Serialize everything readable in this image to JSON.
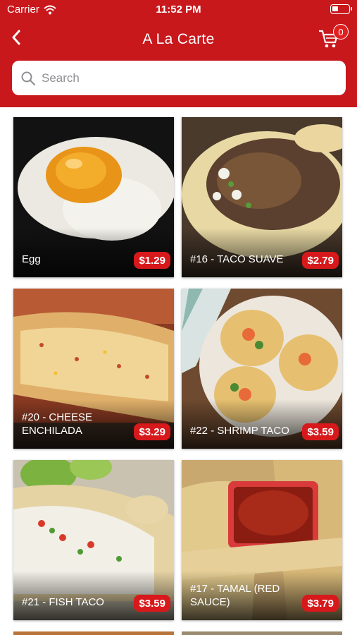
{
  "status": {
    "carrier": "Carrier",
    "time": "11:52 PM"
  },
  "nav": {
    "title": "A La Carte",
    "cart_count": "0"
  },
  "search": {
    "placeholder": "Search"
  },
  "colors": {
    "header": "#c8181c",
    "price_badge": "#d7191c"
  },
  "items": [
    {
      "name": "Egg",
      "price": "$1.29"
    },
    {
      "name": "#16 - TACO SUAVE",
      "price": "$2.79"
    },
    {
      "name": "#20 - CHEESE ENCHILADA",
      "price": "$3.29"
    },
    {
      "name": "#22 - SHRIMP TACO",
      "price": "$3.59"
    },
    {
      "name": "#21 - FISH TACO",
      "price": "$3.59"
    },
    {
      "name": "#17 - TAMAL (RED SAUCE)",
      "price": "$3.79"
    }
  ]
}
